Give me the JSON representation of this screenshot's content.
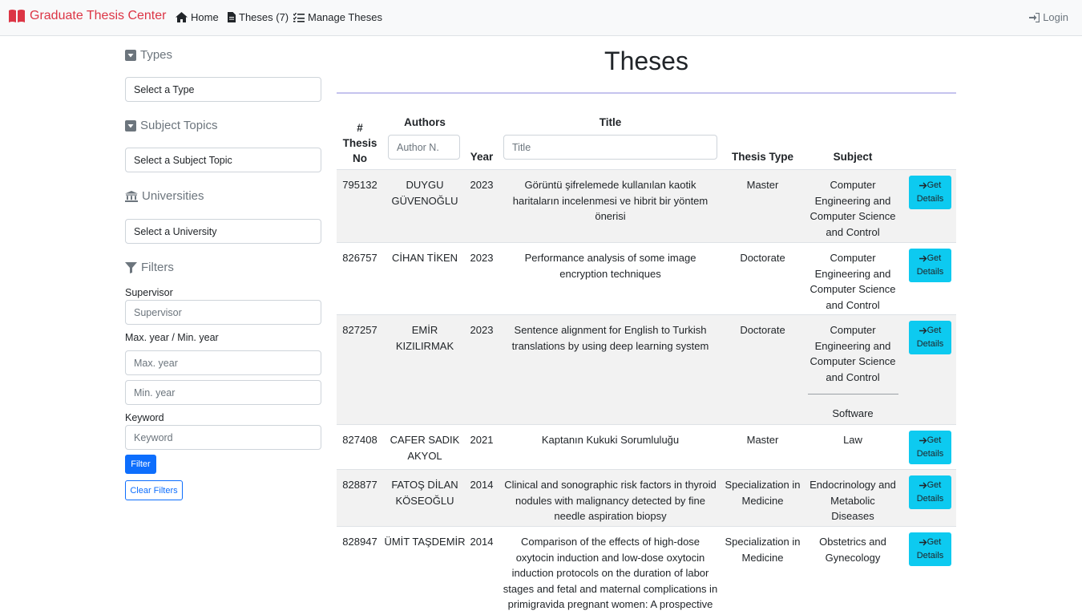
{
  "navbar": {
    "brand": "Graduate Thesis Center",
    "home": "Home",
    "theses": "Theses (7)",
    "manage": "Manage Theses",
    "login": "Login"
  },
  "sidebar": {
    "types_heading": "Types",
    "types_select": "Select a Type",
    "subjects_heading": "Subject Topics",
    "subjects_select": "Select a Subject Topic",
    "universities_heading": "Universities",
    "universities_select": "Select a University",
    "filters_heading": "Filters",
    "supervisor_label": "Supervisor",
    "supervisor_placeholder": "Supervisor",
    "year_label": "Max. year / Min. year",
    "max_year_placeholder": "Max. year",
    "min_year_placeholder": "Min. year",
    "keyword_label": "Keyword",
    "keyword_placeholder": "Keyword",
    "filter_button": "Filter",
    "clear_button": "Clear Filters"
  },
  "main": {
    "title": "Theses",
    "headers": {
      "no_hash": "#",
      "no_line1": "Thesis",
      "no_line2": "No",
      "authors": "Authors",
      "authors_placeholder": "Author N.",
      "year": "Year",
      "title": "Title",
      "title_placeholder": "Title",
      "type": "Thesis Type",
      "subject": "Subject"
    },
    "get_details_line1": "Get",
    "get_details_line2": "Details",
    "rows": [
      {
        "no": "795132",
        "author": "DUYGU GÜVENOĞLU",
        "year": "2023",
        "title": "Görüntü şifrelemede kullanılan kaotik haritaların incelenmesi ve hibrit bir yöntem önerisi",
        "type": "Master",
        "subject": "Computer Engineering and Computer Science and Control"
      },
      {
        "no": "826757",
        "author": "CİHAN TİKEN",
        "year": "2023",
        "title": "Performance analysis of some image encryption techniques",
        "type": "Doctorate",
        "subject": "Computer Engineering and Computer Science and Control"
      },
      {
        "no": "827257",
        "author": "EMİR KIZILIRMAK",
        "year": "2023",
        "title": "Sentence alignment for English to Turkish translations by using deep learning system",
        "type": "Doctorate",
        "subject": "Computer Engineering and Computer Science and Control",
        "subject2": "Software"
      },
      {
        "no": "827408",
        "author": "CAFER SADIK AKYOL",
        "year": "2021",
        "title": "Kaptanın Kukuki Sorumluluğu",
        "type": "Master",
        "subject": "Law"
      },
      {
        "no": "828877",
        "author": "FATOŞ DİLAN KÖSEOĞLU",
        "year": "2014",
        "title": "Clinical and sonographic risk factors in thyroid nodules with malignancy detected by fine needle aspiration biopsy",
        "type": "Specialization in Medicine",
        "subject": "Endocrinology and Metabolic Diseases"
      },
      {
        "no": "828947",
        "author": "ÜMİT TAŞDEMİR",
        "year": "2014",
        "title": "Comparison of the effects of high-dose oxytocin induction and low-dose oxytocin induction protocols on the duration of labor stages and fetal and maternal complications in primigravida pregnant women: A prospective randomized controlled study",
        "type": "Specialization in Medicine",
        "subject": "Obstetrics and Gynecology"
      }
    ]
  }
}
